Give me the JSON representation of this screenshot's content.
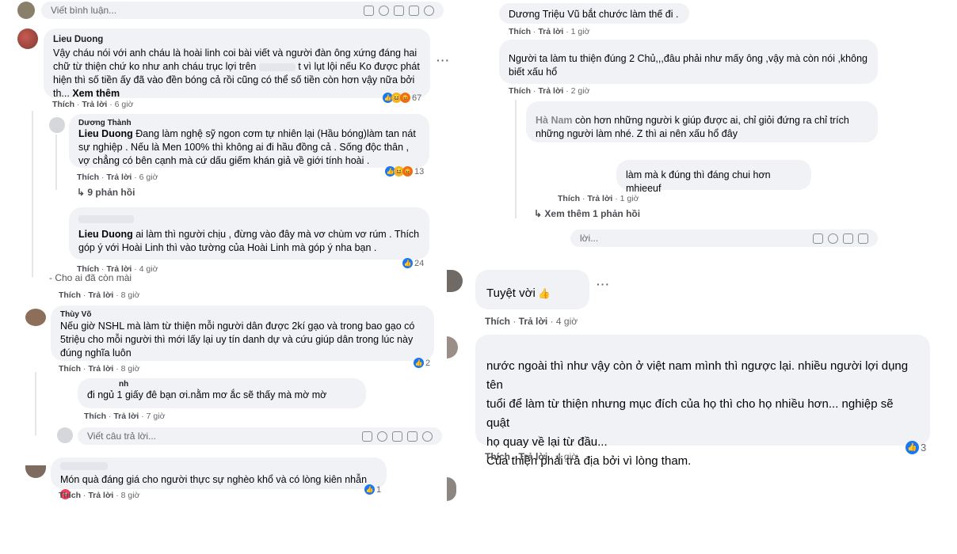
{
  "left": {
    "top_input": {
      "placeholder": "Viết bình luận..."
    },
    "c1": {
      "author": "Lieu Duong",
      "text": "Vậy cháu nói với anh cháu là hoài linh coi bài viết và người đàn ông xứng đáng hai chữ từ thiện chứ ko như anh cháu trục lợi trên",
      "text2": "t vì lụt lội nếu Ko được phát hiện thì số tiền ấy đã vào đền bóng cả rồi cũng có thể số tiền còn hơn vậy nữa bởi th...",
      "see_more": "Xem thêm",
      "like": "Thích",
      "reply": "Trả lời",
      "time": "6 giờ",
      "react_count": "67"
    },
    "r1": {
      "author": "Dương Thành",
      "mention": "Lieu Duong",
      "text": "Đang làm nghệ sỹ ngon cơm tự nhiên lại (Hầu bóng)làm tan nát sự nghiệp . Nếu là Men 100% thì không ai đi hầu đồng cả . Sống độc thân , vợ chẳng có bên cạnh mà cứ dấu giếm khán giả về giới tính hoài .",
      "like": "Thích",
      "reply": "Trả lời",
      "time": "6 giờ",
      "react_count": "13",
      "replies_link": "9 phản hồi"
    },
    "r2": {
      "mention": "Lieu Duong",
      "text": "ai làm thì người chịu , đừng vào đây mà vơ chùm vơ rúm . Thích góp ý với Hoài Linh thì vào tường của Hoài Linh mà góp ý nha bạn .",
      "like": "Thích",
      "reply": "Trả lời",
      "time": "4 giờ",
      "react_count": "24"
    },
    "partial": {
      "text": "- Cho ai đã còn mài",
      "like": "Thích",
      "reply": "Trả lời",
      "time": "8 giờ"
    },
    "c2": {
      "author": "Thùy Võ",
      "text": "Nếu giờ NSHL mà làm từ thiện mỗi người dân được 2kí gạo và trong bao gạo có 5triệu cho mỗi người thì mới lấy lại uy tín danh dự và cứu giúp dân trong lúc này đúng nghĩa luôn",
      "like": "Thích",
      "reply": "Trả lời",
      "time": "8 giờ",
      "react_count": "2"
    },
    "r3": {
      "author": "nh",
      "text": "đi ngủ 1 giấy đê bạn ơi.nằm mơ ắc sẽ thấy mà mờ mờ",
      "like": "Thích",
      "reply": "Trả lời",
      "time": "7 giờ"
    },
    "reply_input": {
      "placeholder": "Viết câu trả lời..."
    },
    "c3": {
      "text": "Món quà đáng giá cho người thực sự nghèo khổ và có lòng kiên nhẫn",
      "like": "Thích",
      "reply": "Trả lời",
      "time": "8 giờ",
      "react_count": "1"
    }
  },
  "right": {
    "c1": {
      "text": "Dương Triệu Vũ bắt chước làm thế đi .",
      "like": "Thích",
      "reply": "Trả lời",
      "time": "1 giờ"
    },
    "c2": {
      "text": "Người ta làm tu thiện đúng 2 Chủ,,,đâu phải như mấy ông ,vậy mà còn nói ,không biết xấu hổ",
      "like": "Thích",
      "reply": "Trả lời",
      "time": "2 giờ"
    },
    "c3": {
      "mention": "Hà Nam",
      "text": "còn hơn những người k giúp được ai, chỉ giỏi đứng ra chỉ trích những người làm nhé. Z thì ai nên xấu hổ đây"
    },
    "c4": {
      "text": "làm mà k đúng thì đáng chui hơn mhieeuf",
      "like": "Thích",
      "reply": "Trả lời",
      "time": "1 giờ"
    },
    "more_replies": "Xem thêm 1 phản hồi",
    "reply_input": {
      "placeholder": "lời..."
    },
    "c5": {
      "text": "Tuyệt vời",
      "like": "Thích",
      "reply": "Trả lời",
      "time": "4 giờ"
    },
    "c6": {
      "line1": "nước ngoài thì như vậy còn ở việt nam mình thì ngược lại. nhiều người lợi dụng tên",
      "line2": "tuổi để làm từ thiện nhưng mục đích của họ thì cho họ nhiều hơn... nghiệp sẽ quật",
      "line3": "họ quay về lại từ đầu...",
      "line4": "Của thiện phải trả địa bởi vì lòng tham.",
      "like": "Thích",
      "reply": "Trả lời",
      "time": "4 giờ",
      "react_count": "3"
    }
  },
  "icons": [
    "sticker-icon",
    "emoji-icon",
    "camera-icon",
    "gif-icon",
    "like-reaction-icon",
    "haha-reaction-icon",
    "angry-reaction-icon",
    "heart-icon",
    "thumbs-up-emoji-icon"
  ]
}
